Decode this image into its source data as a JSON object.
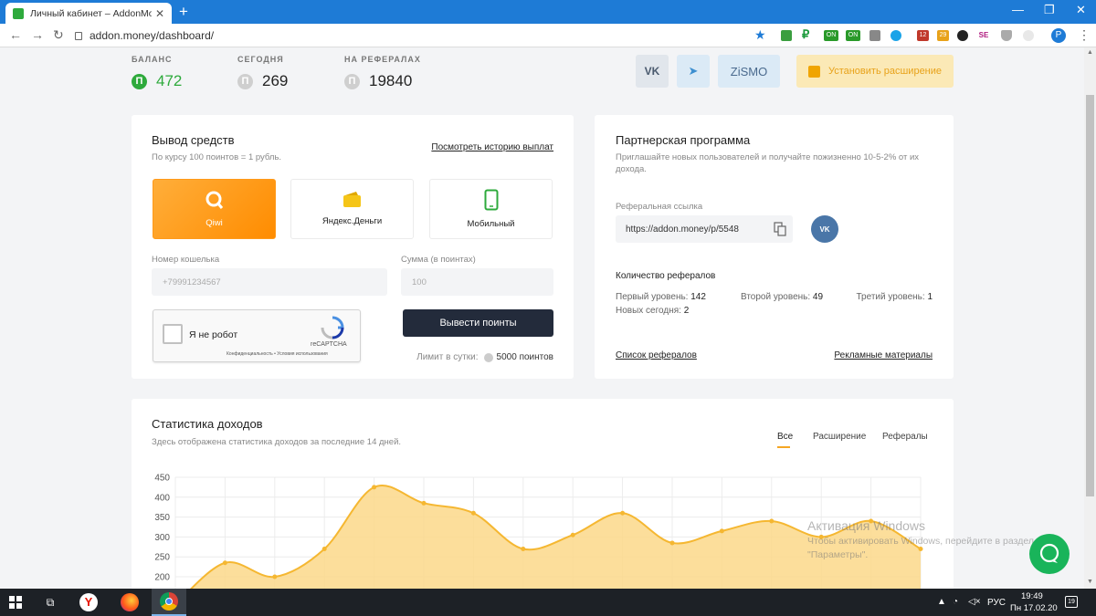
{
  "browser": {
    "tab_title": "Личный кабинет – AddonMoney",
    "tab_close": "✕",
    "new_tab": "+",
    "url": "addon.money/dashboard/",
    "ext_badges": [
      "ON",
      "ON",
      "12",
      "29",
      "SE"
    ],
    "profile_letter": "P"
  },
  "stats": {
    "balance_label": "БАЛАНС",
    "balance_value": "472",
    "today_label": "СЕГОДНЯ",
    "today_value": "269",
    "ref_label": "НА РЕФЕРАЛАХ",
    "ref_value": "19840",
    "coin_symbol": "П"
  },
  "top_buttons": {
    "vk": "VK",
    "telegram": "➤",
    "zismo": "ZiSMO",
    "extension": "Установить расширение"
  },
  "withdraw": {
    "title": "Вывод средств",
    "subtitle": "По курсу 100 поинтов = 1 рубль.",
    "history_link": "Посмотреть историю выплат",
    "methods": [
      {
        "label": "Qiwi"
      },
      {
        "label": "Яндекс.Деньги"
      },
      {
        "label": "Мобильный"
      }
    ],
    "wallet_label": "Номер кошелька",
    "wallet_placeholder": "+79991234567",
    "amount_label": "Сумма (в поинтах)",
    "amount_placeholder": "100",
    "captcha_text": "Я не робот",
    "captcha_brand": "reCAPTCHA",
    "captcha_links": "Конфиденциальность • Условия использования",
    "submit": "Вывести поинты",
    "limit_label": "Лимит в сутки:",
    "limit_value": "5000 поинтов"
  },
  "partner": {
    "title": "Партнерская программа",
    "subtitle": "Приглашайте новых пользователей и получайте пожизненно 10-5-2% от их дохода.",
    "ref_link_label": "Реферальная ссылка",
    "ref_link": "https://addon.money/p/5548",
    "count_title": "Количество рефералов",
    "level1_label": "Первый уровень:",
    "level1_value": "142",
    "level2_label": "Второй уровень:",
    "level2_value": "49",
    "level3_label": "Третий уровень:",
    "level3_value": "1",
    "new_today_label": "Новых сегодня:",
    "new_today_value": "2",
    "list_link": "Список рефералов",
    "promo_link": "Рекламные материалы"
  },
  "income": {
    "title": "Статистика доходов",
    "subtitle": "Здесь отображена статистика доходов за последние 14 дней.",
    "tabs": [
      "Все",
      "Расширение",
      "Рефералы"
    ]
  },
  "chart_data": {
    "type": "area",
    "y_ticks": [
      200,
      250,
      300,
      350,
      400,
      450
    ],
    "ylim": [
      150,
      450
    ],
    "values": [
      130,
      235,
      200,
      270,
      425,
      385,
      360,
      270,
      305,
      360,
      285,
      315,
      340,
      300,
      340,
      270
    ],
    "grid": true,
    "color": "#f5b731",
    "fill": "#fbd88a"
  },
  "watermark": {
    "line1": "Активация Windows",
    "line2": "Чтобы активировать Windows, перейдите в раздел",
    "line3": "\"Параметры\"."
  },
  "taskbar": {
    "lang": "РУС",
    "time": "19:49",
    "date": "Пн 17.02.20",
    "notif_count": "19"
  },
  "colors": {
    "accent_green": "#2eaa3c",
    "qiwi_orange": "#ff8c00",
    "dark_button": "#232b3b",
    "vk_blue": "#4a76a8"
  }
}
